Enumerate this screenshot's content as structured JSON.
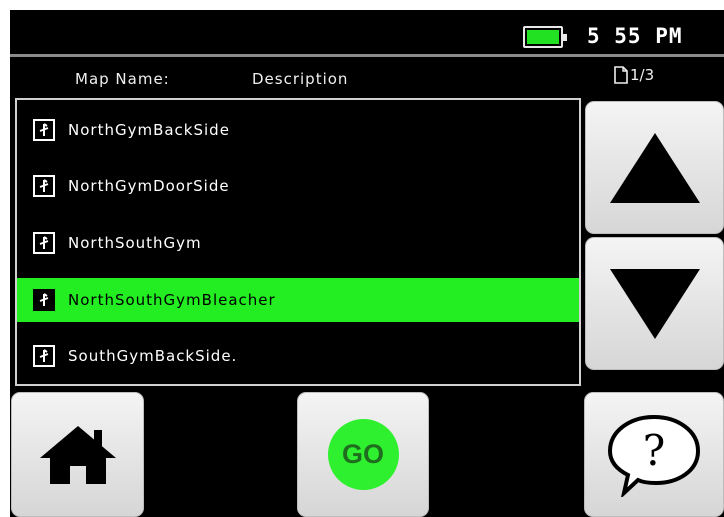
{
  "status": {
    "battery_color": "#22e022",
    "time": "5 55 PM"
  },
  "header": {
    "map_name_label": "Map Name:",
    "description_label": "Description",
    "page_indicator": "1/3"
  },
  "maps": [
    {
      "name": "NorthGymBackSide",
      "selected": false
    },
    {
      "name": "NorthGymDoorSide",
      "selected": false
    },
    {
      "name": "NorthSouthGym",
      "selected": false
    },
    {
      "name": "NorthSouthGymBleacher",
      "selected": true
    },
    {
      "name": "SouthGymBackSide.",
      "selected": false
    }
  ],
  "controls": {
    "scroll_up_icon": "triangle-up-icon",
    "scroll_down_icon": "triangle-down-icon",
    "home_icon": "home-icon",
    "go_label": "GO",
    "go_color": "#2ff02f",
    "help_icon": "question-bubble-icon",
    "selection_color": "#22ee22"
  }
}
